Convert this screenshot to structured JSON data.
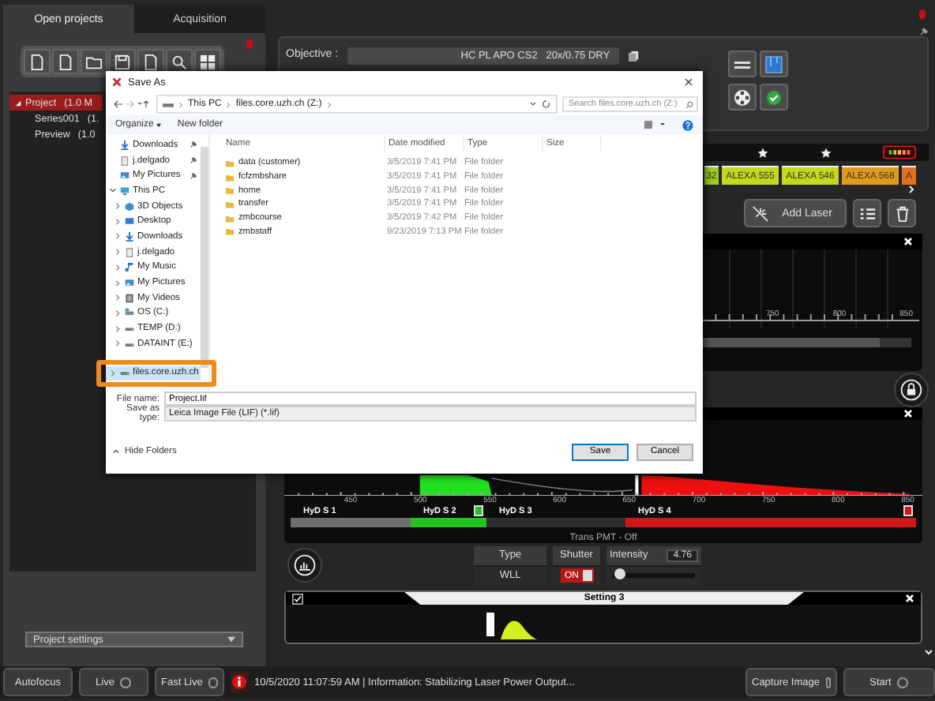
{
  "left_panel": {
    "tabs": [
      {
        "label": "Open projects",
        "selected": true
      },
      {
        "label": "Acquisition",
        "selected": false
      }
    ],
    "tree": [
      {
        "label": "Project",
        "size": "(1.0 M",
        "selected": true,
        "expanded": true,
        "children": [
          {
            "label": "Series001",
            "size": "(1.",
            "selected": false
          },
          {
            "label": "Preview",
            "size": "(1.0",
            "selected": false
          }
        ]
      }
    ],
    "settings_dropdown": "Project settings"
  },
  "objective": {
    "label": "Objective :",
    "value": "HC PL APO CS2   20x/0.75 DRY"
  },
  "dyes": [
    {
      "name": "32",
      "color": "#9ccc1e"
    },
    {
      "name": "ALEXA 555",
      "color": "#c4d81c"
    },
    {
      "name": "ALEXA 546",
      "color": "#c4d81c"
    },
    {
      "name": "ALEXA 568",
      "color": "#e29a1c"
    },
    {
      "name": "A",
      "color": "#e2701c"
    }
  ],
  "add_laser": "Add Laser",
  "spectrum_top": {
    "ticks": [
      "750",
      "800",
      "850"
    ]
  },
  "spectrum_main": {
    "ticks": [
      "450",
      "500",
      "550",
      "600",
      "650",
      "700",
      "750",
      "800",
      "850"
    ],
    "detectors": [
      {
        "name": "HyD S 1",
        "color": "#6e6e6e",
        "active": false
      },
      {
        "name": "HyD S 2",
        "color": "#22c322",
        "active": true
      },
      {
        "name": "HyD S 3",
        "color": "#2e2e2e",
        "active": false
      },
      {
        "name": "HyD S 4",
        "color": "#d01616",
        "active": true
      }
    ],
    "trans": "Trans PMT - Off"
  },
  "laser": {
    "type_label": "Type",
    "type_value": "WLL",
    "shutter_label": "Shutter",
    "shutter_text": "ON",
    "shutter_on": true,
    "intensity_label": "Intensity",
    "intensity_value": "4.76",
    "level": 0.03
  },
  "setting": {
    "title": "Setting 3",
    "checked": true
  },
  "status_bar": {
    "left_buttons": [
      {
        "label": "Autofocus",
        "indicator": false
      },
      {
        "label": "Live",
        "indicator": true
      },
      {
        "label": "Fast Live",
        "indicator": true
      }
    ],
    "message": "10/5/2020 11:07:59 AM | Information: Stabilizing Laser Power Output...",
    "right_buttons": [
      {
        "label": "Capture Image",
        "indicator": true
      },
      {
        "label": "Start",
        "indicator": true
      }
    ]
  },
  "dialog": {
    "title": "Save As",
    "path": [
      "This PC",
      "files.core.uzh.ch (Z:)"
    ],
    "search_placeholder": "Search files.core.uzh.ch (Z:)",
    "toolbar": [
      "Organize",
      "New folder"
    ],
    "nav": [
      {
        "label": "Downloads",
        "kind": "download",
        "pinned": true,
        "selected": false,
        "highlighted": false
      },
      {
        "label": "j.delgado",
        "kind": "document",
        "pinned": true,
        "selected": false,
        "highlighted": false
      },
      {
        "label": "My Pictures",
        "kind": "pictures",
        "pinned": true,
        "selected": false,
        "highlighted": false
      },
      {
        "label": "This PC",
        "kind": "pc",
        "expanded": true,
        "selected": false,
        "highlighted": false,
        "children": [
          {
            "label": "3D Objects",
            "kind": "cube",
            "expanded": false,
            "selected": false,
            "highlighted": false
          },
          {
            "label": "Desktop",
            "kind": "desktop",
            "expanded": false,
            "selected": false,
            "highlighted": false
          },
          {
            "label": "Downloads",
            "kind": "download",
            "expanded": false,
            "selected": false,
            "highlighted": false
          },
          {
            "label": "j.delgado",
            "kind": "document",
            "expanded": false,
            "selected": false,
            "highlighted": false
          },
          {
            "label": "My Music",
            "kind": "music",
            "expanded": false,
            "selected": false,
            "highlighted": false
          },
          {
            "label": "My Pictures",
            "kind": "pictures",
            "expanded": false,
            "selected": false,
            "highlighted": false
          },
          {
            "label": "My Videos",
            "kind": "video",
            "expanded": false,
            "selected": false,
            "highlighted": false
          },
          {
            "label": "OS (C:)",
            "kind": "os",
            "expanded": false,
            "selected": false,
            "highlighted": false
          },
          {
            "label": "TEMP (D:)",
            "kind": "drive",
            "expanded": false,
            "selected": false,
            "highlighted": false
          },
          {
            "label": "DATAINT (E:)",
            "kind": "drive",
            "expanded": false,
            "selected": false,
            "highlighted": false
          }
        ]
      },
      {
        "label": "files.core.uzh.ch",
        "kind": "drive",
        "expanded": false,
        "selected": true,
        "highlighted": true
      }
    ],
    "columns": [
      "Name",
      "Date modified",
      "Type",
      "Size"
    ],
    "files": [
      {
        "name": "data (customer)",
        "date": "3/5/2019 7:41 PM",
        "type": "File folder"
      },
      {
        "name": "fcfzmbshare",
        "date": "3/5/2019 7:41 PM",
        "type": "File folder"
      },
      {
        "name": "home",
        "date": "3/5/2019 7:41 PM",
        "type": "File folder"
      },
      {
        "name": "transfer",
        "date": "3/5/2019 7:41 PM",
        "type": "File folder"
      },
      {
        "name": "zmbcourse",
        "date": "3/5/2019 7:42 PM",
        "type": "File folder"
      },
      {
        "name": "zmbstaff",
        "date": "9/23/2019 7:13 PM",
        "type": "File folder"
      }
    ],
    "file_name_label": "File name:",
    "file_name": "Project.lif",
    "save_type_label": "Save as type:",
    "save_type": "Leica Image File (LIF) (*.lif)",
    "hide_folders": "Hide Folders",
    "buttons": [
      "Save",
      "Cancel"
    ]
  }
}
